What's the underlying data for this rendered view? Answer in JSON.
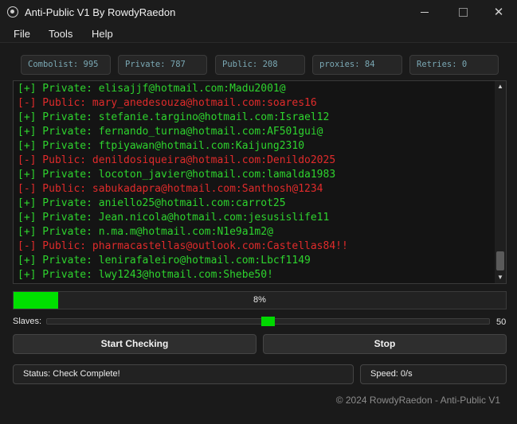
{
  "window": {
    "title": "Anti-Public V1 By RowdyRaedon"
  },
  "menu": {
    "file": "File",
    "tools": "Tools",
    "help": "Help"
  },
  "stats": {
    "combolist": "Combolist: 995",
    "private": "Private: 787",
    "public": "Public: 208",
    "proxies": "proxies: 84",
    "retries": "Retries: 0"
  },
  "log": [
    {
      "text": "[+] Private: elisajjf@hotmail.com:Madu2001@",
      "kind": "ok"
    },
    {
      "text": "[-] Public: mary_anedesouza@hotmail.com:soares16",
      "kind": "bad"
    },
    {
      "text": "[+] Private: stefanie.targino@hotmail.com:Israel12",
      "kind": "ok"
    },
    {
      "text": "[+] Private: fernando_turna@hotmail.com:AF501gui@",
      "kind": "ok"
    },
    {
      "text": "[+] Private: ftpiyawan@hotmail.com:Kaijung2310",
      "kind": "ok"
    },
    {
      "text": "[-] Public: denildosiqueira@hotmail.com:Denildo2025",
      "kind": "bad"
    },
    {
      "text": "[+] Private: locoton_javier@hotmail.com:lamalda1983",
      "kind": "ok"
    },
    {
      "text": "[-] Public: sabukadapra@hotmail.com:Santhosh@1234",
      "kind": "bad"
    },
    {
      "text": "[+] Private: aniello25@hotmail.com:carrot25",
      "kind": "ok"
    },
    {
      "text": "[+] Private: Jean.nicola@hotmail.com:jesusislife11",
      "kind": "ok"
    },
    {
      "text": "[+] Private: n.ma.m@hotmail.com:N1e9a1m2@",
      "kind": "ok"
    },
    {
      "text": "[-] Public: pharmacastellas@outlook.com:Castellas84!!",
      "kind": "bad"
    },
    {
      "text": "[+] Private: lenirafaleiro@hotmail.com:Lbcf1149",
      "kind": "ok"
    },
    {
      "text": "[+] Private: lwy1243@hotmail.com:Shebe50!",
      "kind": "ok"
    }
  ],
  "progress": {
    "label": "8%",
    "value": 0.08
  },
  "slaves": {
    "label": "Slaves:",
    "value": "50",
    "position": 0.5
  },
  "buttons": {
    "start": "Start Checking",
    "stop": "Stop"
  },
  "status": {
    "text": "Status: Check Complete!",
    "speed": "Speed: 0/s"
  },
  "footer": "© 2024 RowdyRaedon - Anti-Public V1",
  "icons": {
    "app": "app-logo-icon",
    "minimize": "minimize-icon",
    "maximize": "maximize-icon",
    "close": "close-icon",
    "scroll_up": "arrow-up-icon",
    "scroll_down": "arrow-down-icon"
  },
  "colors": {
    "ok": "#2ed42e",
    "bad": "#e02b2b",
    "accent": "#00e000"
  }
}
